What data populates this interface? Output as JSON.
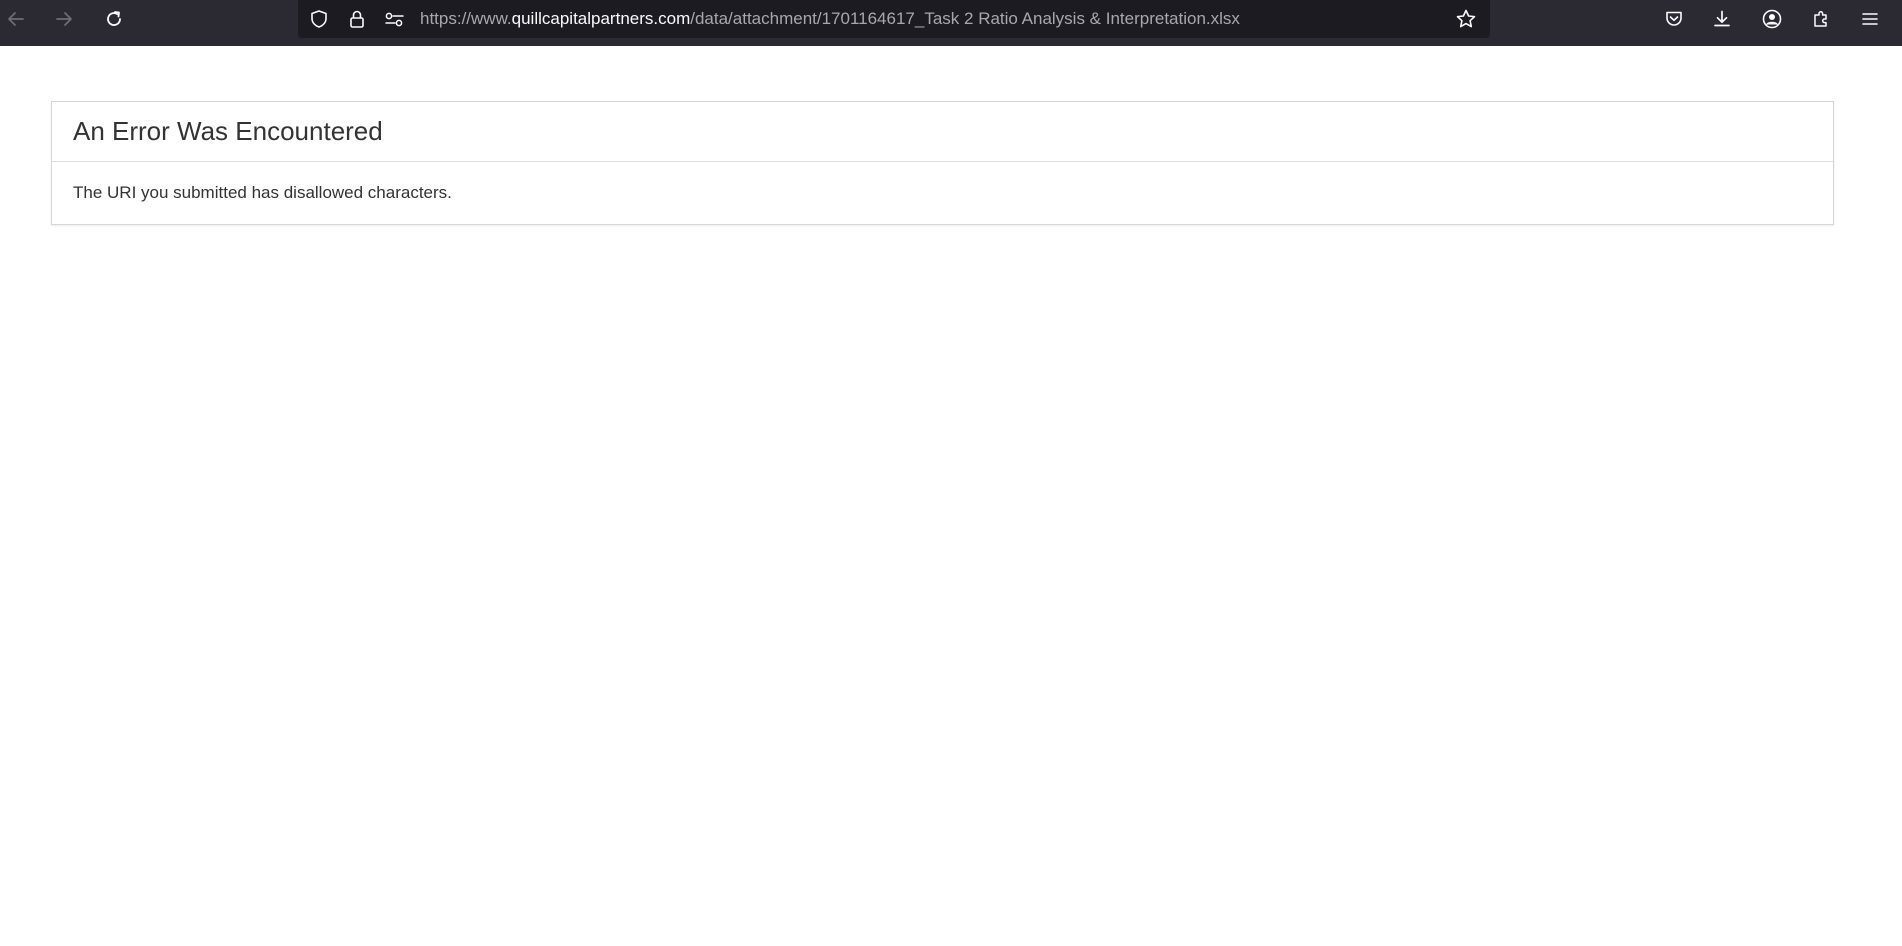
{
  "browser": {
    "url": {
      "prefix": "https://www.",
      "domain": "quillcapitalpartners.com",
      "path": "/data/attachment/1701164617_Task 2 Ratio Analysis & Interpretation.xlsx"
    },
    "icons": {
      "back": "arrow-left-icon",
      "forward": "arrow-right-icon",
      "reload": "reload-icon",
      "tracking_protection": "shield-icon",
      "security": "lock-icon",
      "permissions": "permissions-icon",
      "bookmark": "star-icon",
      "pocket": "pocket-icon",
      "downloads": "download-icon",
      "account": "account-icon",
      "extensions": "puzzle-icon",
      "menu": "hamburger-menu-icon"
    },
    "colors": {
      "toolbar": "#2b2a33",
      "urlbar": "#1c1b22",
      "url_text": "#a8a7ad",
      "url_domain": "#fbfbfe"
    }
  },
  "page": {
    "heading": "An Error Was Encountered",
    "message": "The URI you submitted has disallowed characters.",
    "colors": {
      "text": "#333333",
      "border": "#dddddd"
    }
  }
}
